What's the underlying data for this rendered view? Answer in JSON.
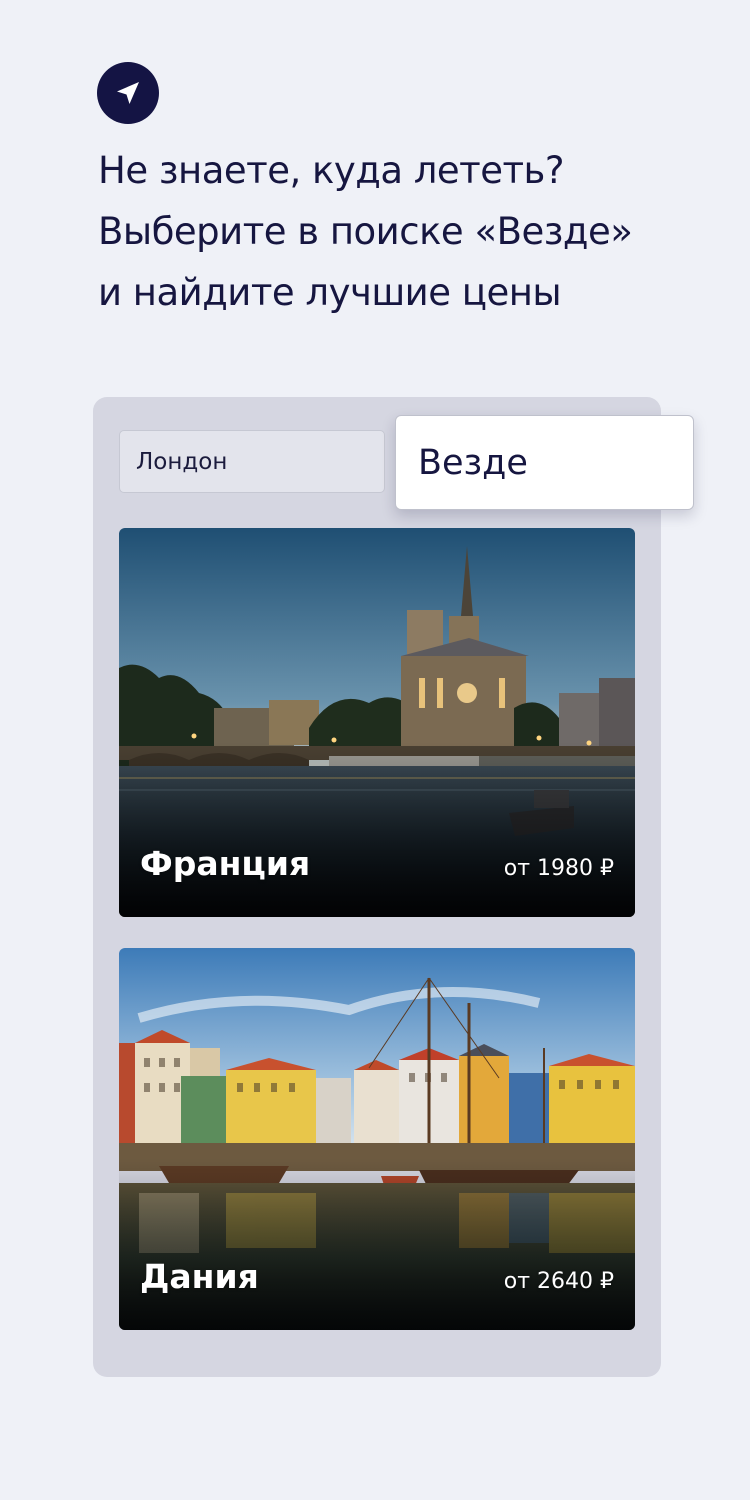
{
  "header": {
    "logo_icon": "paper-plane-icon",
    "headline_lines": [
      "Не знаете, куда лететь?",
      "Выберите в поиске «Везде»",
      "и найдите лучшие цены"
    ]
  },
  "search": {
    "from_value": "Лондон",
    "to_value": "Везде"
  },
  "destinations": [
    {
      "name": "Франция",
      "price": "от 1980 ₽",
      "image": "notre-dame-paris-photo"
    },
    {
      "name": "Дания",
      "price": "от 2640 ₽",
      "image": "nyhavn-copenhagen-photo"
    }
  ],
  "colors": {
    "brand_navy": "#141444",
    "background": "#eff1f7",
    "panel": "#d5d6e1"
  }
}
